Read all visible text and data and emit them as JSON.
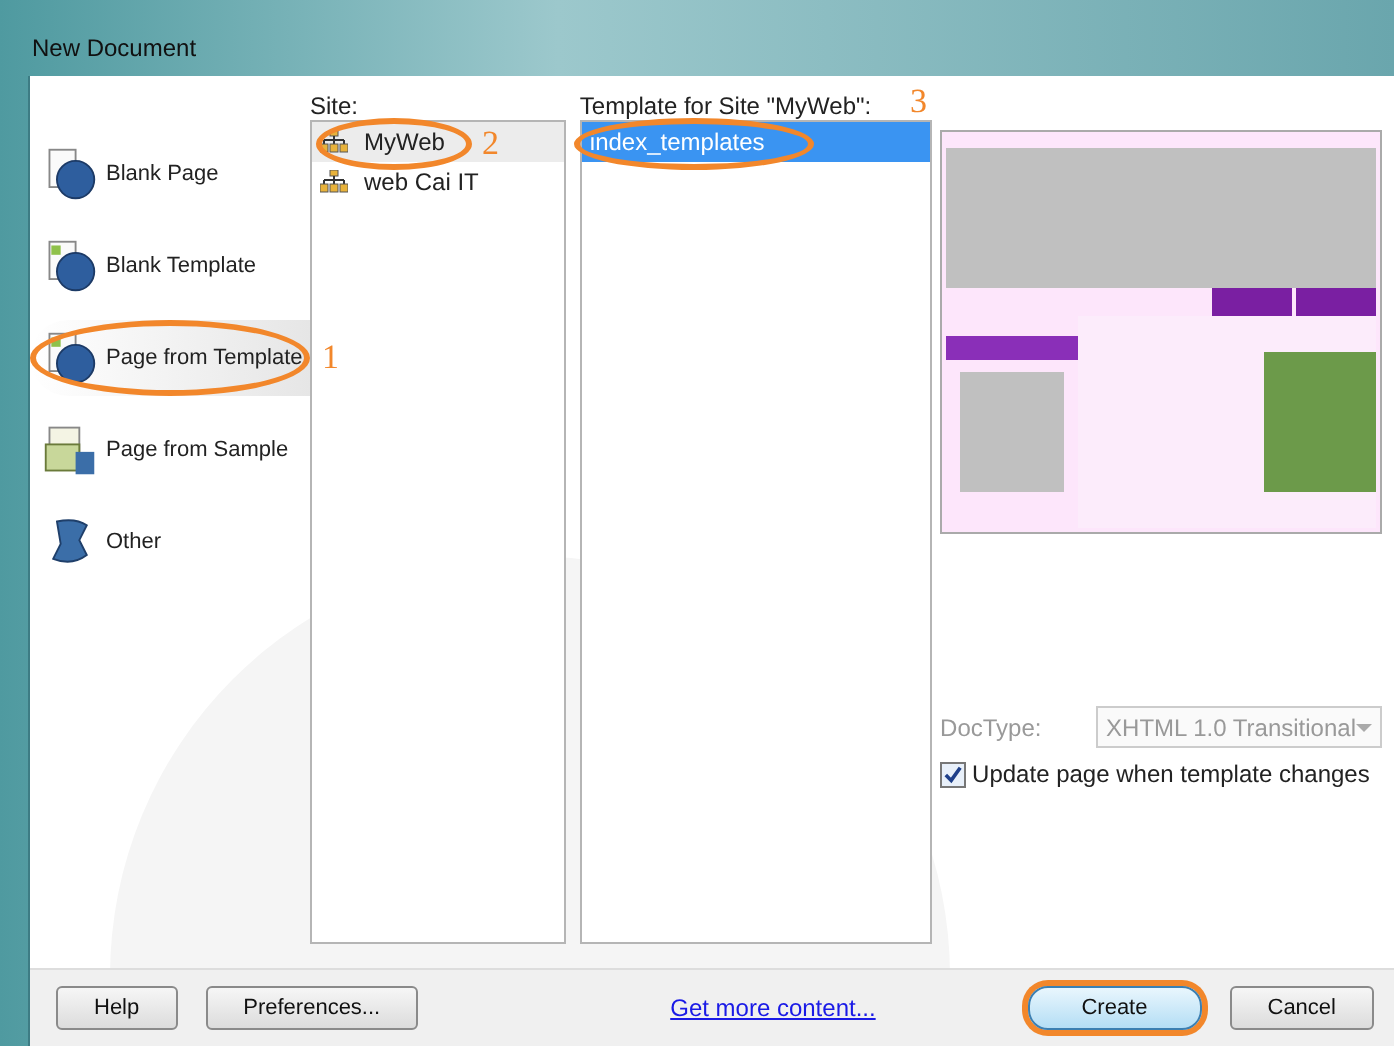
{
  "window": {
    "title": "New Document"
  },
  "categories": [
    {
      "label": "Blank Page",
      "kind": "page",
      "selected": false
    },
    {
      "label": "Blank Template",
      "kind": "template",
      "selected": false
    },
    {
      "label": "Page from Template",
      "kind": "fromtemplate",
      "selected": true
    },
    {
      "label": "Page from Sample",
      "kind": "sample",
      "selected": false
    },
    {
      "label": "Other",
      "kind": "other",
      "selected": false
    }
  ],
  "sites": {
    "label": "Site:",
    "items": [
      {
        "label": "MyWeb",
        "selected": true
      },
      {
        "label": "web Cai IT",
        "selected": false
      }
    ]
  },
  "templates": {
    "label": "Template for Site \"MyWeb\":",
    "items": [
      {
        "label": "index_templates",
        "selected": true
      }
    ]
  },
  "doctype": {
    "label": "DocType:",
    "value": "XHTML 1.0 Transitional",
    "disabled": true
  },
  "update_checkbox": {
    "label": "Update page when template changes",
    "checked": true
  },
  "buttons": {
    "help": "Help",
    "preferences": "Preferences...",
    "link": "Get more content...",
    "create": "Create",
    "cancel": "Cancel"
  },
  "annotations": [
    {
      "number": "1"
    },
    {
      "number": "2"
    },
    {
      "number": "3"
    }
  ]
}
